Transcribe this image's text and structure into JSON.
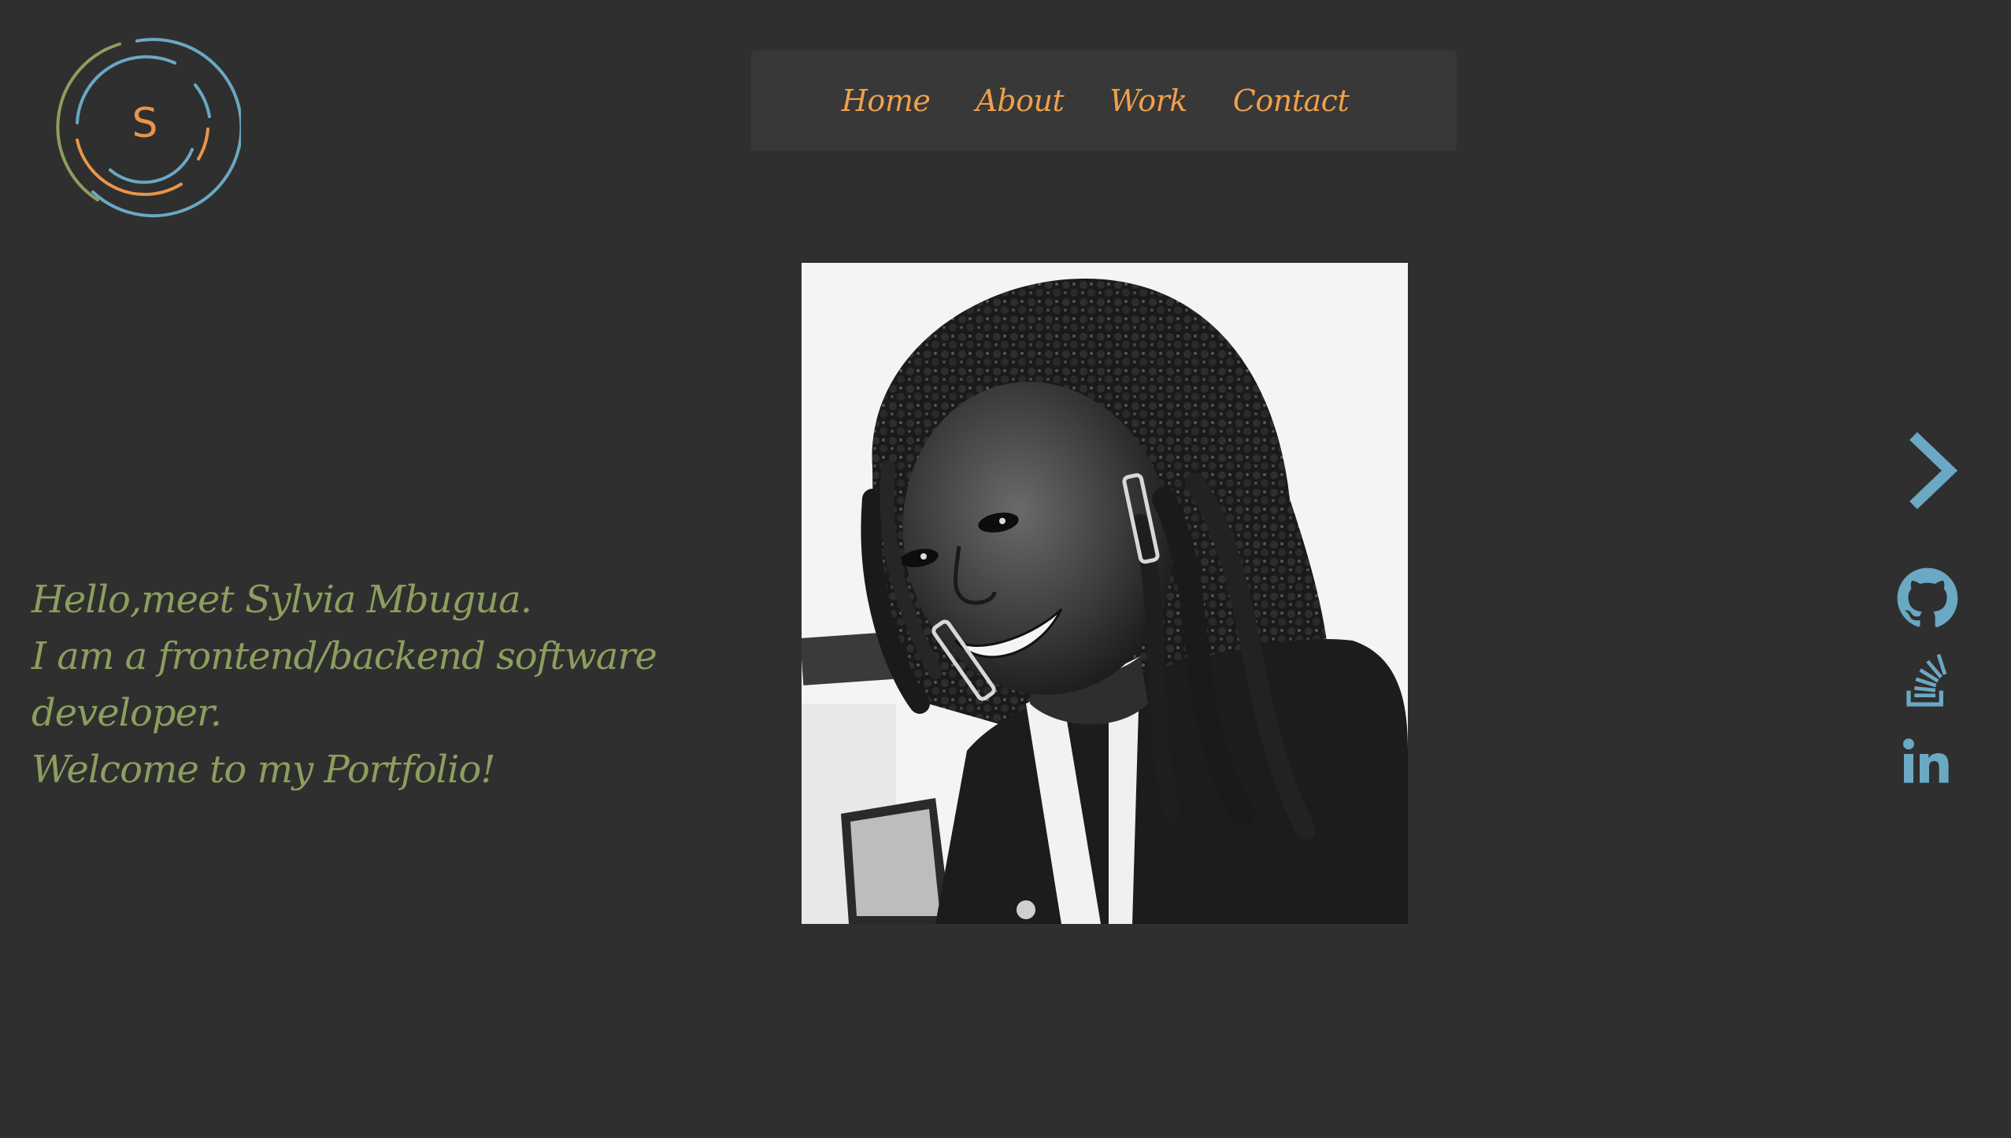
{
  "logo": {
    "letter": "S",
    "colors": [
      "#8c9e5e",
      "#6aa8c4",
      "#e8954a"
    ]
  },
  "nav": {
    "items": [
      {
        "label": "Home"
      },
      {
        "label": "About"
      },
      {
        "label": "Work"
      },
      {
        "label": "Contact"
      }
    ],
    "link_color": "#f0a04b"
  },
  "intro": {
    "lines": [
      "Hello,meet Sylvia Mbugua.",
      "I am a frontend/backend software",
      "developer.",
      "Welcome to my Portfolio!"
    ],
    "color": "#8c9e5e"
  },
  "photo": {
    "icon": "profile-photo"
  },
  "side": {
    "next_icon": "chevron-right-icon",
    "social": [
      {
        "icon": "github-icon"
      },
      {
        "icon": "stackoverflow-icon"
      },
      {
        "icon": "linkedin-icon"
      }
    ],
    "color": "#6aa8c4"
  },
  "colors": {
    "background": "#2f2f2f",
    "nav_background": "#383838"
  }
}
